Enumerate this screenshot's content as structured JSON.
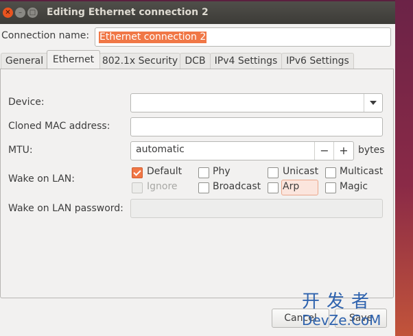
{
  "window": {
    "title": "Editing Ethernet connection 2"
  },
  "connection": {
    "label": "Connection name:",
    "value": "Ethernet connection 2"
  },
  "tabs": [
    "General",
    "Ethernet",
    "802.1x Security",
    "DCB",
    "IPv4 Settings",
    "IPv6 Settings"
  ],
  "active_tab": "Ethernet",
  "ethernet": {
    "device_label": "Device:",
    "device_value": "",
    "cloned_mac_label": "Cloned MAC address:",
    "cloned_mac_value": "",
    "mtu_label": "MTU:",
    "mtu_value": "automatic",
    "mtu_minus": "−",
    "mtu_plus": "+",
    "mtu_unit": "bytes",
    "wol_label": "Wake on LAN:",
    "wol_options": {
      "default": "Default",
      "phy": "Phy",
      "unicast": "Unicast",
      "multicast": "Multicast",
      "ignore": "Ignore",
      "broadcast": "Broadcast",
      "arp": "Arp",
      "magic": "Magic"
    },
    "wol_password_label": "Wake on LAN password:",
    "wol_password_value": ""
  },
  "buttons": {
    "cancel": "Cancel",
    "save": "Save"
  },
  "watermark": {
    "line1": "开发者",
    "line2": "DevZe.CoM"
  },
  "colors": {
    "accent": "#f07746",
    "titlebar": "#3c3b37",
    "close": "#e95420"
  }
}
